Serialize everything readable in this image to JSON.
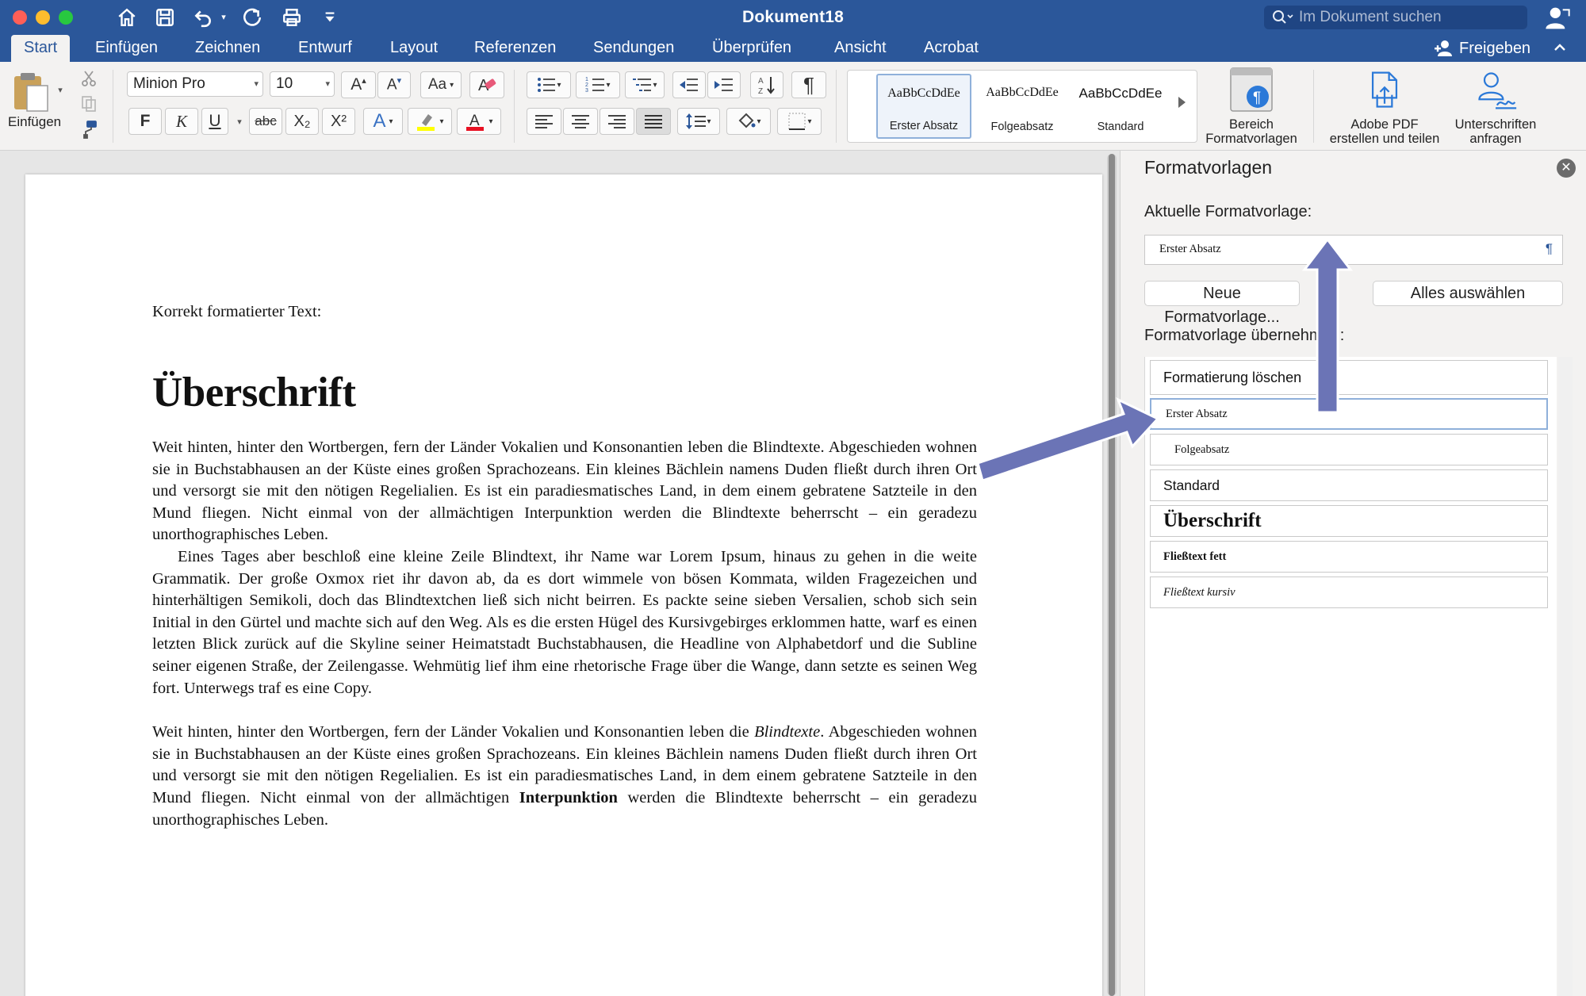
{
  "window": {
    "title": "Dokument18",
    "search_placeholder": "Im Dokument suchen"
  },
  "quick_access": {
    "icons": [
      "home-icon",
      "save-icon",
      "undo-icon",
      "redo-icon",
      "print-icon",
      "customize-icon"
    ]
  },
  "tabs": [
    {
      "label": "Start",
      "active": true
    },
    {
      "label": "Einfügen"
    },
    {
      "label": "Zeichnen"
    },
    {
      "label": "Entwurf"
    },
    {
      "label": "Layout"
    },
    {
      "label": "Referenzen"
    },
    {
      "label": "Sendungen"
    },
    {
      "label": "Überprüfen"
    },
    {
      "label": "Ansicht"
    },
    {
      "label": "Acrobat"
    }
  ],
  "share_label": "Freigeben",
  "ribbon": {
    "paste_label": "Einfügen",
    "font_name": "Minion Pro",
    "font_size": "10",
    "format_buttons": {
      "bold": "F",
      "italic": "K",
      "underline": "U",
      "strike": "abc",
      "subscript": "X₂",
      "superscript": "X²"
    },
    "styles_gallery": [
      {
        "preview": "AaBbCcDdEe",
        "label": "Erster Absatz",
        "selected": true
      },
      {
        "preview": "AaBbCcDdEe",
        "label": "Folgeabsatz"
      },
      {
        "preview": "AaBbCcDdEe",
        "label": "Standard"
      }
    ],
    "styles_pane_button": {
      "line1": "Bereich",
      "line2": "Formatvorlagen"
    },
    "adobe_pdf_button": {
      "line1": "Adobe PDF",
      "line2": "erstellen und teilen"
    },
    "signatures_button": {
      "line1": "Unterschriften",
      "line2": "anfragen"
    },
    "colors": {
      "highlight": "#ffff00",
      "font_color": "#e81123"
    }
  },
  "document": {
    "intro": "Korrekt formatierter Text:",
    "heading": "Überschrift",
    "para1": "Weit hinten, hinter den Wortbergen, fern der Länder Vokalien und Konsonantien leben die Blindtexte. Abgeschieden wohnen sie in Buchstabhausen an der Küste eines großen Sprachozeans. Ein kleines Bächlein namens Duden fließt durch ihren Ort und versorgt sie mit den nötigen Regelialien. Es ist ein paradiesmatisches Land, in dem einem gebratene Satzteile in den Mund fliegen. Nicht einmal von der allmächtigen Interpunktion werden die Blindtexte beherrscht – ein geradezu unorthographisches Leben.",
    "para2": "Eines Tages aber beschloß eine kleine Zeile Blindtext, ihr Name war Lorem Ipsum, hinaus zu gehen in die weite Grammatik. Der große Oxmox riet ihr davon ab, da es dort wimmele von bösen Kommata, wilden Fragezeichen und hinterhältigen Semikoli, doch das Blindtextchen ließ sich nicht beirren. Es packte seine sieben Versalien, schob sich sein Initial in den Gürtel und machte sich auf den Weg. Als es die ersten Hügel des Kursivgebirges erklommen hatte, warf es einen letzten Blick zurück auf die Skyline seiner Heimatstadt Buchstabhausen, die Headline von Alphabetdorf und die Subline seiner eigenen Straße, der Zeilengasse. Wehmütig lief ihm eine rhetorische Frage über die Wange, dann setzte es seinen Weg fort. Unterwegs traf es eine Copy.",
    "para3": {
      "part1": "Weit hinten, hinter den Wortbergen, fern der Länder Vokalien und Konsonantien leben die ",
      "italic": "Blindtexte",
      "part2": ". Abgeschieden wohnen sie in Buchstabhausen an der Küste eines großen Sprachozeans. Ein kleines Bächlein namens Duden fließt durch ihren Ort und versorgt sie mit den nötigen Regelialien. Es ist ein paradiesmatisches Land, in dem einem gebratene Satzteile in den Mund fliegen. Nicht einmal von der allmächtigen ",
      "bold": "Interpunktion",
      "part3": " werden die Blindtexte beherrscht – ein geradezu unorthographisches Leben."
    }
  },
  "styles_pane": {
    "title": "Formatvorlagen",
    "current_label": "Aktuelle Formatvorlage:",
    "current_value": "Erster Absatz",
    "new_style_button": "Neue Formatvorlage...",
    "select_all_button": "Alles auswählen",
    "apply_label": "Formatvorlage übernehmen:",
    "list": [
      {
        "label": "Formatierung löschen"
      },
      {
        "label": "Erster Absatz",
        "selected": true
      },
      {
        "label": "Folgeabsatz"
      },
      {
        "label": "Standard"
      },
      {
        "label": "Überschrift"
      },
      {
        "label": "Fließtext fett"
      },
      {
        "label": "Fließtext kursiv"
      }
    ]
  }
}
